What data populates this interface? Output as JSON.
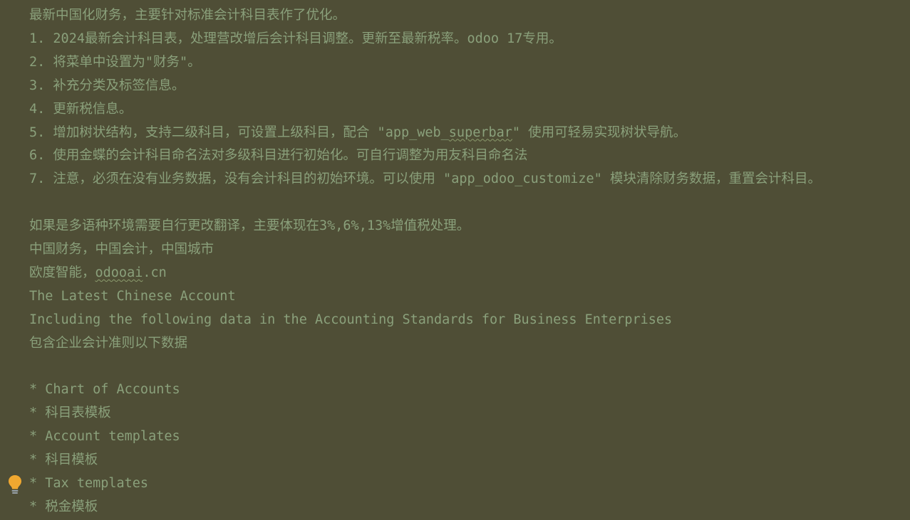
{
  "editor": {
    "lines": [
      {
        "id": "line-1",
        "parts": [
          {
            "t": "最新中国化财务，主要针对标准会计科目表作了优化。"
          }
        ]
      },
      {
        "id": "line-2",
        "parts": [
          {
            "t": "1. 2024最新会计科目表，处理营改增后会计科目调整。更新至最新税率。odoo 17专用。"
          }
        ]
      },
      {
        "id": "line-3",
        "parts": [
          {
            "t": "2. 将菜单中设置为\"财务\"。"
          }
        ]
      },
      {
        "id": "line-4",
        "parts": [
          {
            "t": "3. 补充分类及标签信息。"
          }
        ]
      },
      {
        "id": "line-5",
        "parts": [
          {
            "t": "4. 更新税信息。"
          }
        ]
      },
      {
        "id": "line-6",
        "parts": [
          {
            "t": "5. 增加树状结构，支持二级科目，可设置上级科目，配合 \"app_web_"
          },
          {
            "t": "superbar",
            "spell": true
          },
          {
            "t": "\" 使用可轻易实现树状导航。"
          }
        ]
      },
      {
        "id": "line-7",
        "parts": [
          {
            "t": "6. 使用金蝶的会计科目命名法对多级科目进行初始化。可自行调整为用友科目命名法"
          }
        ]
      },
      {
        "id": "line-8",
        "parts": [
          {
            "t": "7. 注意，必须在没有业务数据，没有会计科目的初始环境。可以使用 \"app_odoo_customize\" 模块清除财务数据，重置会计科目。"
          }
        ]
      },
      {
        "id": "line-9",
        "parts": [
          {
            "t": ""
          }
        ]
      },
      {
        "id": "line-10",
        "parts": [
          {
            "t": "如果是多语种环境需要自行更改翻译，主要体现在3%,6%,13%增值税处理。"
          }
        ]
      },
      {
        "id": "line-11",
        "parts": [
          {
            "t": "中国财务，中国会计，中国城市"
          }
        ]
      },
      {
        "id": "line-12",
        "parts": [
          {
            "t": "欧度智能，"
          },
          {
            "t": "odooai",
            "spell": true
          },
          {
            "t": ".cn"
          }
        ]
      },
      {
        "id": "line-13",
        "parts": [
          {
            "t": "The Latest Chinese Account"
          }
        ]
      },
      {
        "id": "line-14",
        "parts": [
          {
            "t": "Including the following data in the Accounting Standards for Business Enterprises"
          }
        ]
      },
      {
        "id": "line-15",
        "parts": [
          {
            "t": "包含企业会计准则以下数据"
          }
        ]
      },
      {
        "id": "line-16",
        "parts": [
          {
            "t": ""
          }
        ]
      },
      {
        "id": "line-17",
        "parts": [
          {
            "t": "* Chart of Accounts"
          }
        ]
      },
      {
        "id": "line-18",
        "parts": [
          {
            "t": "* 科目表模板"
          }
        ]
      },
      {
        "id": "line-19",
        "parts": [
          {
            "t": "* Account templates"
          }
        ]
      },
      {
        "id": "line-20",
        "parts": [
          {
            "t": "* 科目模板"
          }
        ]
      },
      {
        "id": "line-21",
        "parts": [
          {
            "t": "* Tax templates"
          }
        ]
      },
      {
        "id": "line-22",
        "parts": [
          {
            "t": "* 税金模板"
          }
        ]
      }
    ]
  },
  "gutter": {
    "intention_icon": "lightbulb-icon",
    "intention_color": "#f0a830"
  },
  "colors": {
    "background": "#4f4e36",
    "text": "#8aa07b"
  }
}
